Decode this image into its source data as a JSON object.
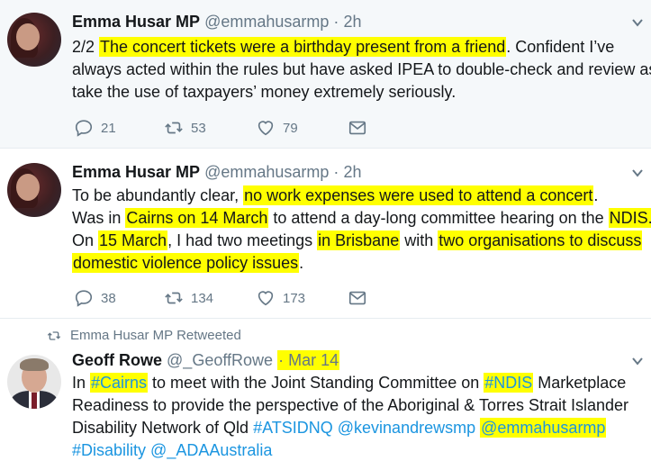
{
  "tweets": [
    {
      "author_name": "Emma Husar MP",
      "handle": "@emmahusarmp",
      "time": "2h",
      "lines": [
        [
          {
            "t": "2/2 "
          },
          {
            "t": "The concert tickets were a birthday present from a friend",
            "hl": true
          },
          {
            "t": ". Confident I’ve"
          }
        ],
        [
          {
            "t": "always acted within the rules but have asked IPEA to double-check and review as I"
          }
        ],
        [
          {
            "t": "take the use of taxpayers’ money extremely seriously."
          }
        ]
      ],
      "replies": "21",
      "retweets": "53",
      "likes": "79"
    },
    {
      "author_name": "Emma Husar MP",
      "handle": "@emmahusarmp",
      "time": "2h",
      "lines": [
        [
          {
            "t": "To be abundantly clear, "
          },
          {
            "t": "no work expenses were used to attend a concert",
            "hl": true
          },
          {
            "t": "."
          }
        ],
        [
          {
            "t": "Was in "
          },
          {
            "t": "Cairns on 14 March",
            "hl": true
          },
          {
            "t": " to attend a day-long committee hearing on the "
          },
          {
            "t": "NDIS.",
            "hl": true
          }
        ],
        [
          {
            "t": "On "
          },
          {
            "t": "15 March",
            "hl": true
          },
          {
            "t": ", I had two meetings "
          },
          {
            "t": "in Brisbane",
            "hl": true
          },
          {
            "t": " with "
          },
          {
            "t": "two organisations to discuss",
            "hl": true
          }
        ],
        [
          {
            "t": "domestic violence policy issues",
            "hl": true
          },
          {
            "t": "."
          }
        ]
      ],
      "replies": "38",
      "retweets": "134",
      "likes": "173"
    },
    {
      "retweet_label": "Emma Husar MP Retweeted",
      "author_name": "Geoff Rowe",
      "handle": "@_GeoffRowe",
      "time": "Mar 14",
      "lines": [
        [
          {
            "t": "In "
          },
          {
            "t": "#Cairns",
            "hl": true,
            "link": true
          },
          {
            "t": " to meet with the Joint Standing Committee on "
          },
          {
            "t": "#NDIS",
            "hl": true,
            "link": true
          },
          {
            "t": " Marketplace"
          }
        ],
        [
          {
            "t": "Readiness to provide the perspective of the Aboriginal & Torres Strait Islander"
          }
        ],
        [
          {
            "t": "Disability Network of Qld "
          },
          {
            "t": "#ATSIDNQ",
            "link": true
          },
          {
            "t": " "
          },
          {
            "t": "@kevinandrewsmp",
            "link": true
          },
          {
            "t": " "
          },
          {
            "t": "@emmahusarmp",
            "hl": true,
            "link": true
          }
        ],
        [
          {
            "t": "#Disability",
            "link": true
          },
          {
            "t": " "
          },
          {
            "t": "@_ADAAustralia",
            "link": true
          }
        ]
      ]
    }
  ],
  "icons": {
    "reply": "reply-icon",
    "retweet": "retweet-icon",
    "like": "heart-icon",
    "dm": "envelope-icon",
    "more": "chevron-down-icon"
  },
  "colors": {
    "highlight": "#ffff00",
    "link": "#1b95e0",
    "muted": "#657786"
  }
}
